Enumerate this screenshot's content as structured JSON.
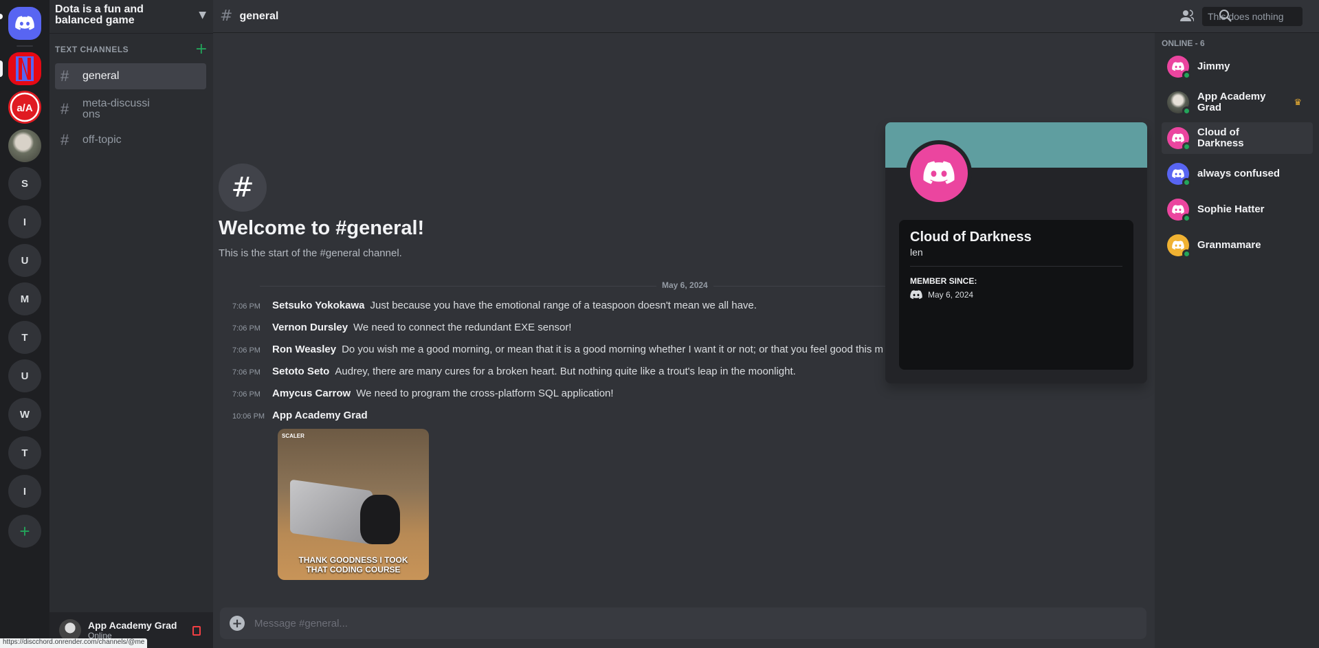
{
  "server_rail": {
    "home_icon": "discord-icon",
    "servers": [
      {
        "name": "netflix-server",
        "letter": ""
      },
      {
        "name": "app-academy-server",
        "letter": ""
      },
      {
        "name": "photo-server",
        "letter": ""
      },
      {
        "name": "S",
        "letter": "S"
      },
      {
        "name": "I",
        "letter": "I"
      },
      {
        "name": "U",
        "letter": "U"
      },
      {
        "name": "M",
        "letter": "M"
      },
      {
        "name": "T",
        "letter": "T"
      },
      {
        "name": "U",
        "letter": "U"
      },
      {
        "name": "W",
        "letter": "W"
      },
      {
        "name": "T",
        "letter": "T"
      },
      {
        "name": "I",
        "letter": "I"
      }
    ],
    "add_label": "+",
    "aa_label": "a/A"
  },
  "guild": {
    "name": "Dota is a fun and balanced game",
    "category": "TEXT CHANNELS",
    "channels": [
      {
        "name": "general",
        "active": true
      },
      {
        "name": "meta-discussions",
        "active": false
      },
      {
        "name": "off-topic",
        "active": false
      }
    ]
  },
  "user_panel": {
    "name": "App Academy Grad",
    "status": "Online"
  },
  "status_url": "https://discchord.onrender.com/channels/@me",
  "header": {
    "channel": "general",
    "search_placeholder": "This does nothing"
  },
  "welcome": {
    "title": "Welcome to #general!",
    "subtitle": "This is the start of the #general channel."
  },
  "date_divider": "May 6, 2024",
  "messages": [
    {
      "time": "7:06 PM",
      "author": "Setsuko Yokokawa",
      "text": "Just because you have the emotional range of a teaspoon doesn't mean we all have."
    },
    {
      "time": "7:06 PM",
      "author": "Vernon Dursley",
      "text": "We need to connect the redundant EXE sensor!"
    },
    {
      "time": "7:06 PM",
      "author": "Ron Weasley",
      "text": "Do you wish me a good morning, or mean that it is a good morning whether I want it or not; or that you feel good this m"
    },
    {
      "time": "7:06 PM",
      "author": "Setoto Seto",
      "text": "Audrey, there are many cures for a broken heart. But nothing quite like a trout's leap in the moonlight."
    },
    {
      "time": "7:06 PM",
      "author": "Amycus Carrow",
      "text": "We need to program the cross-platform SQL application!"
    },
    {
      "time": "10:06 PM",
      "author": "App Academy Grad",
      "text": ""
    }
  ],
  "gif": {
    "brand": "SCALER",
    "caption_line1": "THANK GOODNESS I TOOK",
    "caption_line2": "THAT CODING COURSE"
  },
  "composer": {
    "placeholder": "Message #general..."
  },
  "profile_popout": {
    "display_name": "Cloud of Darkness",
    "username": "len",
    "member_since_label": "MEMBER SINCE:",
    "member_since": "May 6, 2024",
    "banner_color": "#5f9ea0",
    "avatar_color": "#eb459f"
  },
  "members": {
    "header": "ONLINE - 6",
    "list": [
      {
        "name": "Jimmy",
        "color": "#eb459f",
        "owner": false
      },
      {
        "name": "App Academy Grad",
        "color": "photo",
        "owner": true
      },
      {
        "name": "Cloud of Darkness",
        "color": "#eb459f",
        "owner": false
      },
      {
        "name": "always confused",
        "color": "#5865f2",
        "owner": false
      },
      {
        "name": "Sophie Hatter",
        "color": "#eb459f",
        "owner": false
      },
      {
        "name": "Granmamare",
        "color": "#f0b232",
        "owner": false
      }
    ]
  },
  "colors": {
    "accent": "#5865f2",
    "online": "#23a55a",
    "crown": "#f0b232",
    "danger": "#f23f43"
  }
}
